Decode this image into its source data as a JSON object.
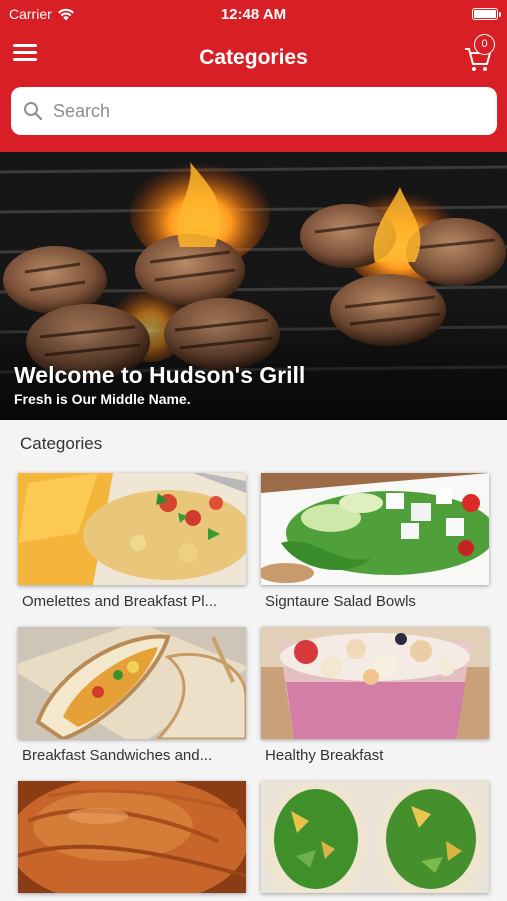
{
  "status_bar": {
    "carrier": "Carrier",
    "time": "12:48 AM"
  },
  "nav": {
    "title": "Categories",
    "cart_count": "0"
  },
  "search": {
    "placeholder": "Search"
  },
  "hero": {
    "title": "Welcome to Hudson's Grill",
    "subtitle": "Fresh is Our Middle Name."
  },
  "section": {
    "label": "Categories"
  },
  "categories": [
    {
      "label": "Omelettes and Breakfast Pl..."
    },
    {
      "label": "Signtaure Salad Bowls"
    },
    {
      "label": "Breakfast Sandwiches and..."
    },
    {
      "label": "Healthy Breakfast"
    },
    {
      "label": ""
    },
    {
      "label": ""
    }
  ],
  "colors": {
    "brand_red": "#d81f26"
  }
}
